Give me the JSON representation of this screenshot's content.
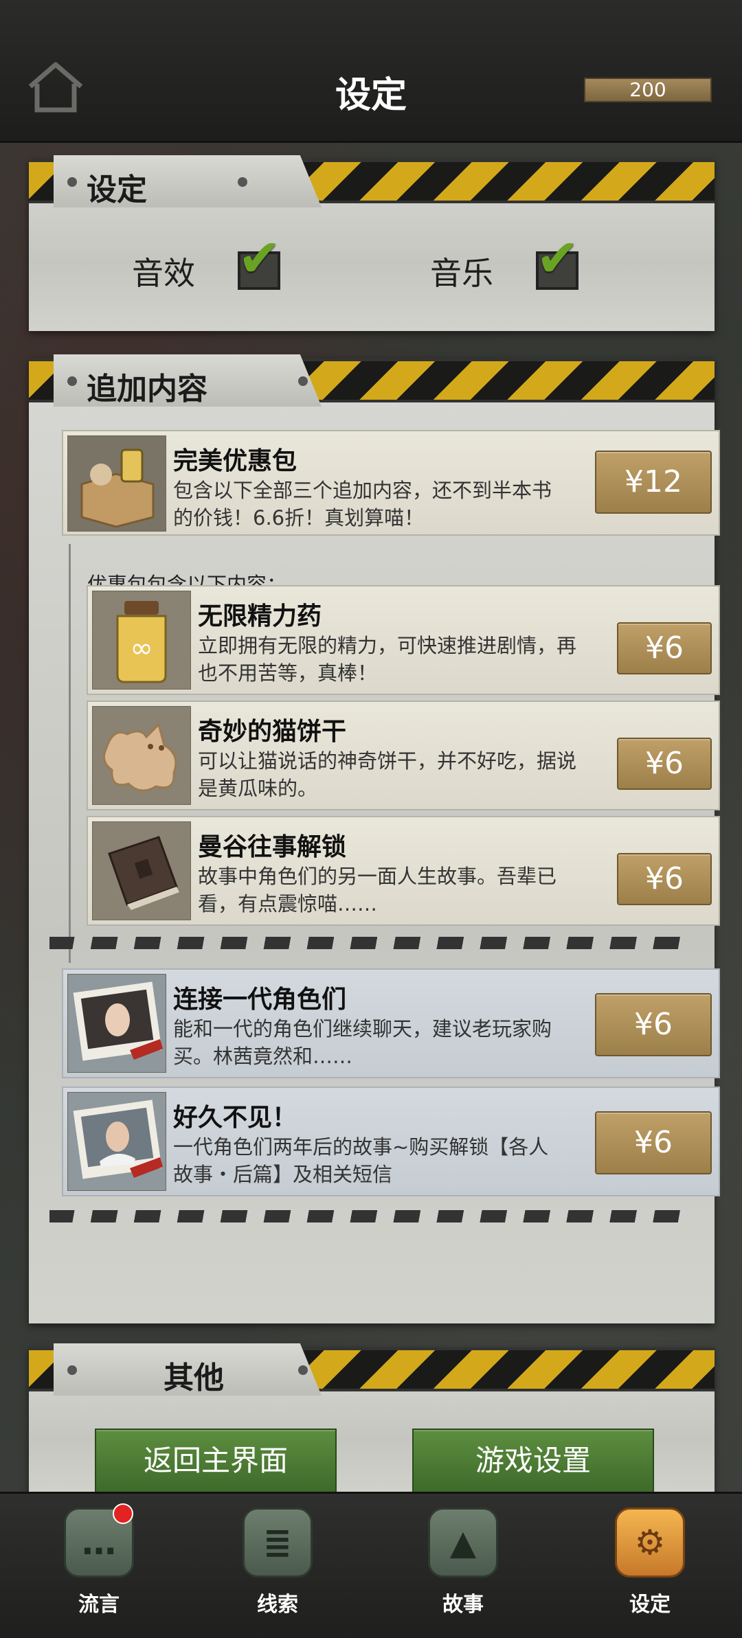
{
  "header": {
    "title": "设定",
    "coins": "200",
    "home_icon": "home-icon"
  },
  "settings": {
    "title": "设定",
    "sound_label": "音效",
    "music_label": "音乐",
    "sound_enabled": true,
    "music_enabled": true
  },
  "addons": {
    "title": "追加内容",
    "bundle": {
      "title": "完美优惠包",
      "desc": "包含以下全部三个追加内容，还不到半本书的价钱！6.6折！真划算喵！",
      "price": "¥12"
    },
    "bundle_note": "优惠包包含以下内容：",
    "bundle_items": [
      {
        "title": "无限精力药",
        "desc": "立即拥有无限的精力，可快速推进剧情，再也不用苦等，真棒！",
        "price": "¥6",
        "icon": "potion-jar-icon"
      },
      {
        "title": "奇妙的猫饼干",
        "desc": "可以让猫说话的神奇饼干，并不好吃，据说是黄瓜味的。",
        "price": "¥6",
        "icon": "cat-cookie-icon"
      },
      {
        "title": "曼谷往事解锁",
        "desc": "故事中角色们的另一面人生故事。吾辈已看，有点震惊喵……",
        "price": "¥6",
        "icon": "book-icon"
      }
    ],
    "extra_items": [
      {
        "title": "连接一代角色们",
        "desc": "能和一代的角色们继续聊天，建议老玩家购买。林茜竟然和……",
        "price": "¥6",
        "icon": "photo-woman-icon"
      },
      {
        "title": "好久不见！",
        "desc": "一代角色们两年后的故事~购买解锁【各人故事・后篇】及相关短信",
        "price": "¥6",
        "icon": "photo-man-icon"
      }
    ]
  },
  "other": {
    "title": "其他",
    "back_button": "返回主界面",
    "game_settings_button": "游戏设置"
  },
  "nav": [
    {
      "label": "流言",
      "icon": "chat-bubble-icon",
      "badge": true
    },
    {
      "label": "线索",
      "icon": "scroll-icon",
      "badge": false
    },
    {
      "label": "故事",
      "icon": "tower-icon",
      "badge": false
    },
    {
      "label": "设定",
      "icon": "gears-icon",
      "badge": false,
      "active": true
    }
  ]
}
